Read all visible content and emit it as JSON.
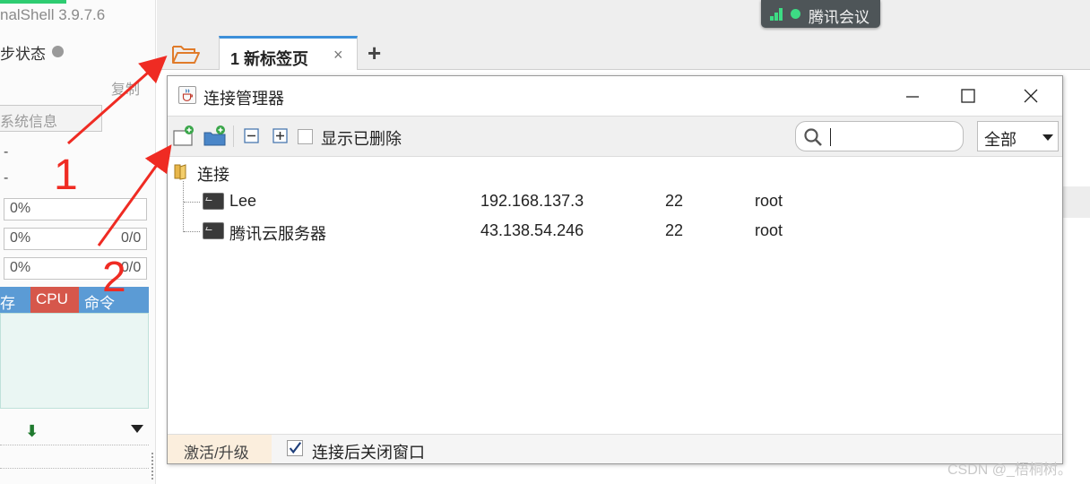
{
  "app": {
    "title": "nalShell 3.9.7.6"
  },
  "left_panel": {
    "sync_status_label": "步状态",
    "copy_label": "复制",
    "sysinfo_button": "系统信息",
    "dash1": "-",
    "dash2": "-",
    "cpu_percent": "0%",
    "mem_percent": "0%",
    "swap_percent": "0%",
    "mem_extra": "0/0",
    "swap_extra": "0/0",
    "proc_table": {
      "col_partial": "存",
      "col_cpu": "CPU",
      "col_cmd": "命令"
    }
  },
  "tabs": {
    "open_folder_icon": "folder-open-icon",
    "items": [
      {
        "label": "1 新标签页",
        "close": "×"
      }
    ],
    "add_label": "+"
  },
  "tencent_meeting": {
    "label": "腾讯会议",
    "color": "#3ddc84"
  },
  "dialog": {
    "title": "连接管理器",
    "toolbar": {
      "show_deleted_label": "显示已删除",
      "show_deleted_checked": false,
      "search": {
        "value": "",
        "placeholder": ""
      },
      "filter": {
        "selected": "全部"
      }
    },
    "tree": {
      "root_label": "连接",
      "connections": [
        {
          "name": "Lee",
          "host": "192.168.137.3",
          "port": "22",
          "user": "root"
        },
        {
          "name": "腾讯云服务器",
          "host": "43.138.54.246",
          "port": "22",
          "user": "root"
        }
      ]
    },
    "status": {
      "activate_label": "激活/升级",
      "close_after_label": "连接后关闭窗口",
      "close_after_checked": true
    }
  },
  "annotations": {
    "num1": "1",
    "num2": "2",
    "arrow_color": "#ef2b23"
  },
  "watermark": "CSDN @_梧桐树。"
}
